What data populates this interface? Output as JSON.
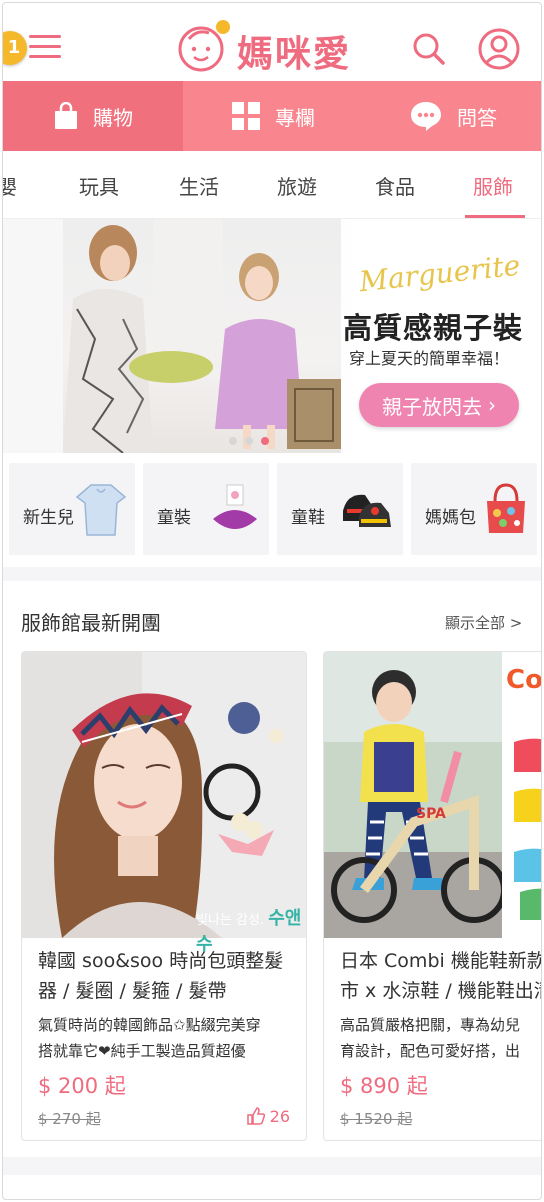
{
  "header": {
    "badge": "1",
    "logo_text": "媽咪愛"
  },
  "main_tabs": [
    {
      "label": "購物",
      "icon": "shopping-bag-icon"
    },
    {
      "label": "專欄",
      "icon": "grid-icon"
    },
    {
      "label": "問答",
      "icon": "chat-bubble-icon"
    }
  ],
  "category_tabs": [
    "嬰",
    "玩具",
    "生活",
    "旅遊",
    "食品",
    "服飾"
  ],
  "active_category": "服飾",
  "banner": {
    "script_text": "Marguerite",
    "title": "高質感親子裝",
    "subtitle": "穿上夏天的簡單幸福！",
    "cta": "親子放閃去",
    "cta_arrow": "›"
  },
  "quick_categories": [
    {
      "label": "新生兒",
      "icon": "baby-romper-icon"
    },
    {
      "label": "童裝",
      "icon": "tutu-dress-icon"
    },
    {
      "label": "童鞋",
      "icon": "kids-shoes-icon"
    },
    {
      "label": "媽媽包",
      "icon": "mommy-bag-icon"
    }
  ],
  "section": {
    "title": "服飾館最新開團",
    "show_all": "顯示全部 >"
  },
  "products": [
    {
      "title": "韓國 soo&soo 時尚包頭整髮\n器 / 髮圈 / 髮箍 / 髮帶",
      "desc": "氣質時尚的韓國飾品✩點綴完美穿\n搭就靠它❤純手工製造品質超優",
      "price": "$ 200 起",
      "original_price": "$ 270 起",
      "likes": "26",
      "watermark_small": "빛나는 감성.",
      "watermark_brand": "수앤수"
    },
    {
      "title": "日本 Combi 機能鞋新款上\n市 x 水涼鞋 / 機能鞋出清",
      "desc": "高品質嚴格把關，專為幼兒\n育設計，配色可愛好搭，出",
      "price": "$ 890 起",
      "original_price": "$ 1520 起",
      "brand_fragment": "Co"
    }
  ],
  "colors": {
    "brand_pink": "#ef6b7f",
    "tab_bar": "#f9868f",
    "tab_active": "#f0707d",
    "cta_pink": "#f084b0",
    "badge_yellow": "#f6b82b"
  }
}
